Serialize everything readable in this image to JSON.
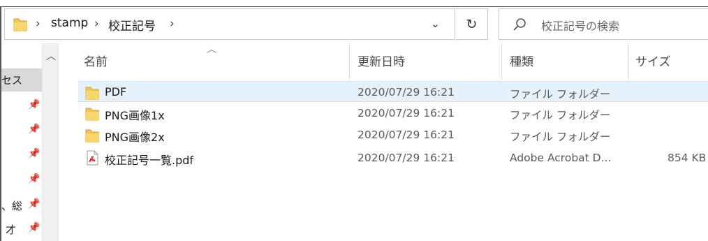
{
  "address": {
    "breadcrumbs": [
      "stamp",
      "校正記号"
    ],
    "separator": "›"
  },
  "search": {
    "placeholder": "校正記号の検索"
  },
  "columns": {
    "name": "名前",
    "modified": "更新日時",
    "type": "種類",
    "size": "サイズ"
  },
  "files": [
    {
      "name": "PDF",
      "modified": "2020/07/29 16:21",
      "type": "ファイル フォルダー",
      "size": "",
      "icon": "folder-icon",
      "selected": true
    },
    {
      "name": "PNG画像1x",
      "modified": "2020/07/29 16:21",
      "type": "ファイル フォルダー",
      "size": "",
      "icon": "folder-icon",
      "selected": false
    },
    {
      "name": "PNG画像2x",
      "modified": "2020/07/29 16:21",
      "type": "ファイル フォルダー",
      "size": "",
      "icon": "folder-icon",
      "selected": false
    },
    {
      "name": "校正記号一覧.pdf",
      "modified": "2020/07/29 16:21",
      "type": "Adobe Acrobat D...",
      "size": "854 KB",
      "icon": "pdf-icon",
      "selected": false
    }
  ],
  "navpane": {
    "partial_labels": [
      "セス",
      "、総",
      "才"
    ]
  },
  "colors": {
    "selection": "#e5f1fb",
    "folder": "#f4c44e",
    "pdf_red": "#d9342b"
  }
}
